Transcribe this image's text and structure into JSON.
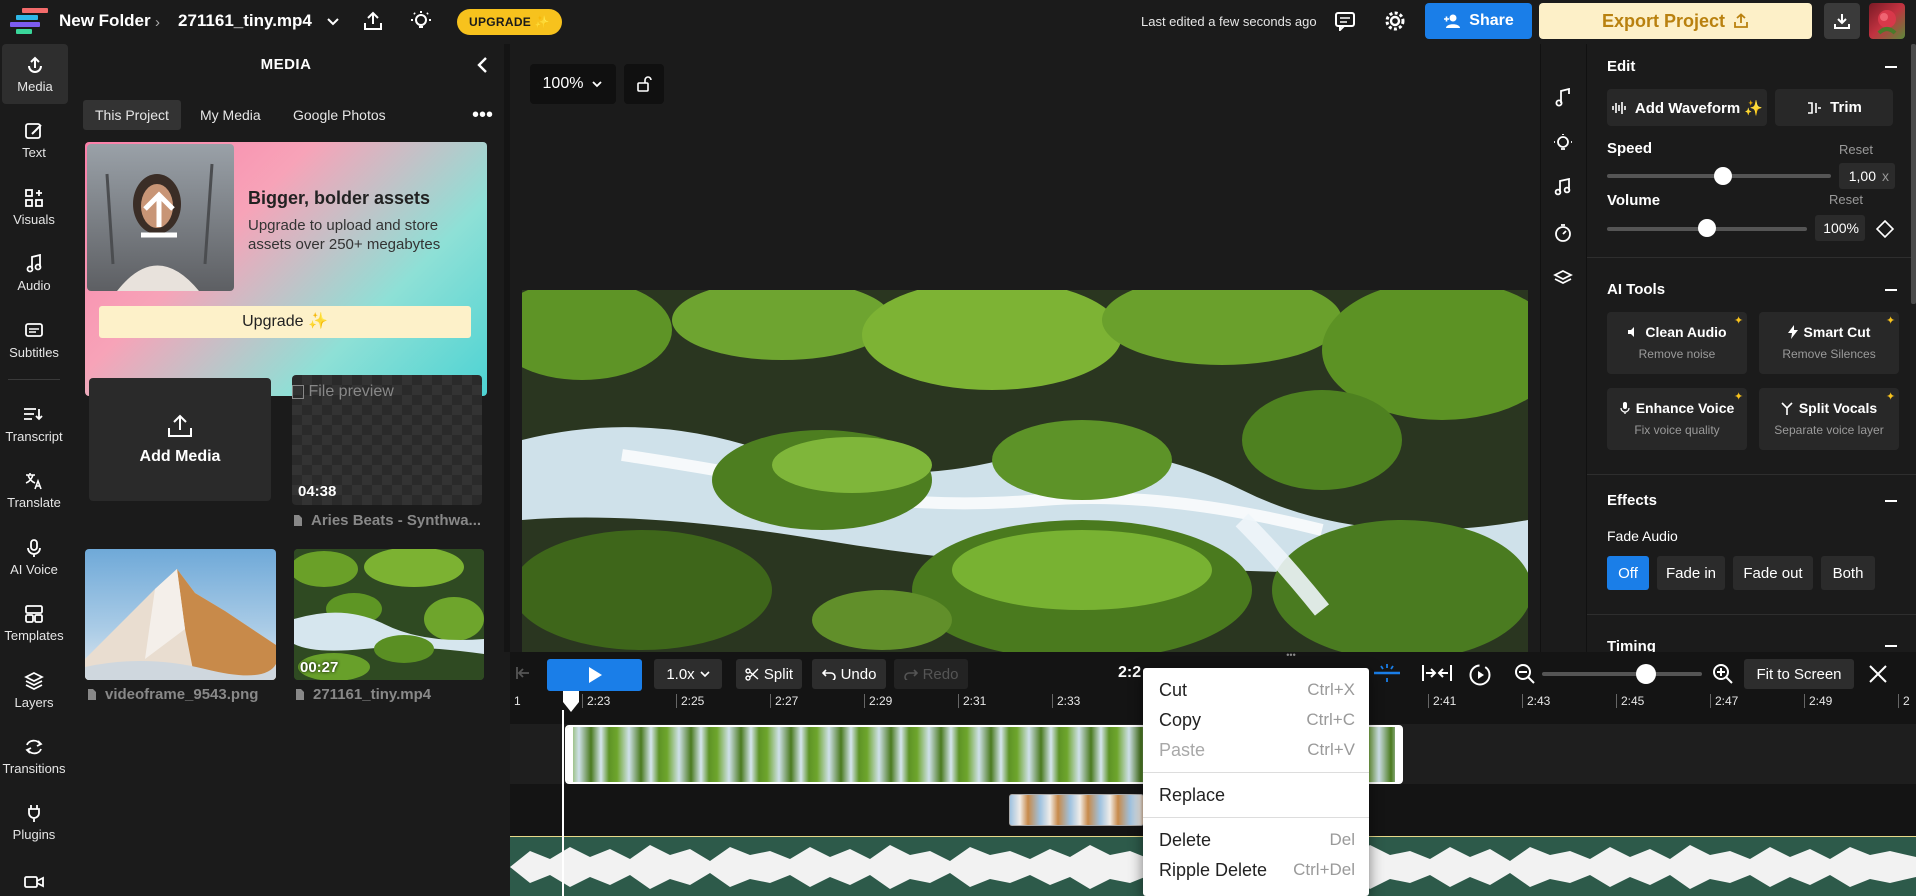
{
  "topbar": {
    "breadcrumb_folder": "New Folder",
    "file_name": "271161_tiny.mp4",
    "upgrade_label": "UPGRADE ✨",
    "last_edited": "Last edited a few seconds ago",
    "share_label": "Share",
    "export_label": "Export Project"
  },
  "rail": {
    "items": [
      {
        "label": "Media",
        "icon": "upload-icon"
      },
      {
        "label": "Text",
        "icon": "text-edit-icon"
      },
      {
        "label": "Visuals",
        "icon": "shapes-icon"
      },
      {
        "label": "Audio",
        "icon": "music-note-icon"
      },
      {
        "label": "Subtitles",
        "icon": "subtitles-icon"
      },
      {
        "label": "Transcript",
        "icon": "transcript-icon"
      },
      {
        "label": "Translate",
        "icon": "translate-icon"
      },
      {
        "label": "AI Voice",
        "icon": "microphone-icon"
      },
      {
        "label": "Templates",
        "icon": "templates-icon"
      },
      {
        "label": "Layers",
        "icon": "layers-icon"
      },
      {
        "label": "Transitions",
        "icon": "transitions-icon"
      },
      {
        "label": "Plugins",
        "icon": "plug-icon"
      }
    ]
  },
  "media": {
    "title": "MEDIA",
    "tabs": [
      "This Project",
      "My Media",
      "Google Photos"
    ],
    "promo": {
      "heading": "Bigger, bolder assets",
      "body": "Upgrade to upload and store assets over 250+ megabytes",
      "button": "Upgrade ✨"
    },
    "add_media_label": "Add Media",
    "items": [
      {
        "name": "Aries Beats - Synthwa...",
        "duration": "04:38",
        "preview_alt": "File preview"
      },
      {
        "name": "videoframe_9543.png",
        "duration": ""
      },
      {
        "name": "271161_tiny.mp4",
        "duration": "00:27"
      }
    ]
  },
  "stage": {
    "zoom": "100%"
  },
  "right_panel": {
    "edit": {
      "title": "Edit",
      "add_waveform": "Add Waveform ✨",
      "trim": "Trim",
      "speed_label": "Speed",
      "speed_reset": "Reset",
      "speed_value": "1,00",
      "speed_unit": "x",
      "speed_level": 0.52,
      "volume_label": "Volume",
      "volume_reset": "Reset",
      "volume_value": "100%",
      "volume_level": 0.5
    },
    "ai_tools": {
      "title": "AI Tools",
      "tools": [
        {
          "name": "Clean Audio",
          "desc": "Remove noise"
        },
        {
          "name": "Smart Cut",
          "desc": "Remove Silences"
        },
        {
          "name": "Enhance Voice",
          "desc": "Fix voice quality"
        },
        {
          "name": "Split Vocals",
          "desc": "Separate voice layer"
        }
      ]
    },
    "effects": {
      "title": "Effects",
      "fade_label": "Fade Audio",
      "options": [
        "Off",
        "Fade in",
        "Fade out",
        "Both"
      ],
      "selected": "Off"
    },
    "timing": {
      "title": "Timing"
    }
  },
  "timeline": {
    "speed": "1.0x",
    "split": "Split",
    "undo": "Undo",
    "redo": "Redo",
    "time_display": "2:2",
    "fit_label": "Fit to Screen",
    "zoom_level": 0.65,
    "ticks": [
      "1",
      "2:23",
      "2:25",
      "2:27",
      "2:29",
      "2:31",
      "2:33",
      "2:41",
      "2:43",
      "2:45",
      "2:47",
      "2:49",
      "2"
    ]
  },
  "context_menu": {
    "items": [
      {
        "label": "Cut",
        "shortcut": "Ctrl+X"
      },
      {
        "label": "Copy",
        "shortcut": "Ctrl+C"
      },
      {
        "label": "Paste",
        "shortcut": "Ctrl+V"
      },
      {
        "label": "Replace",
        "shortcut": ""
      },
      {
        "label": "Delete",
        "shortcut": "Del"
      },
      {
        "label": "Ripple Delete",
        "shortcut": "Ctrl+Del"
      }
    ]
  },
  "colors": {
    "accent_blue": "#1a7ee8",
    "upgrade_yellow": "#f7c21d",
    "export_bg": "#fdf0c8",
    "waveform_green": "#2d5a4a"
  }
}
